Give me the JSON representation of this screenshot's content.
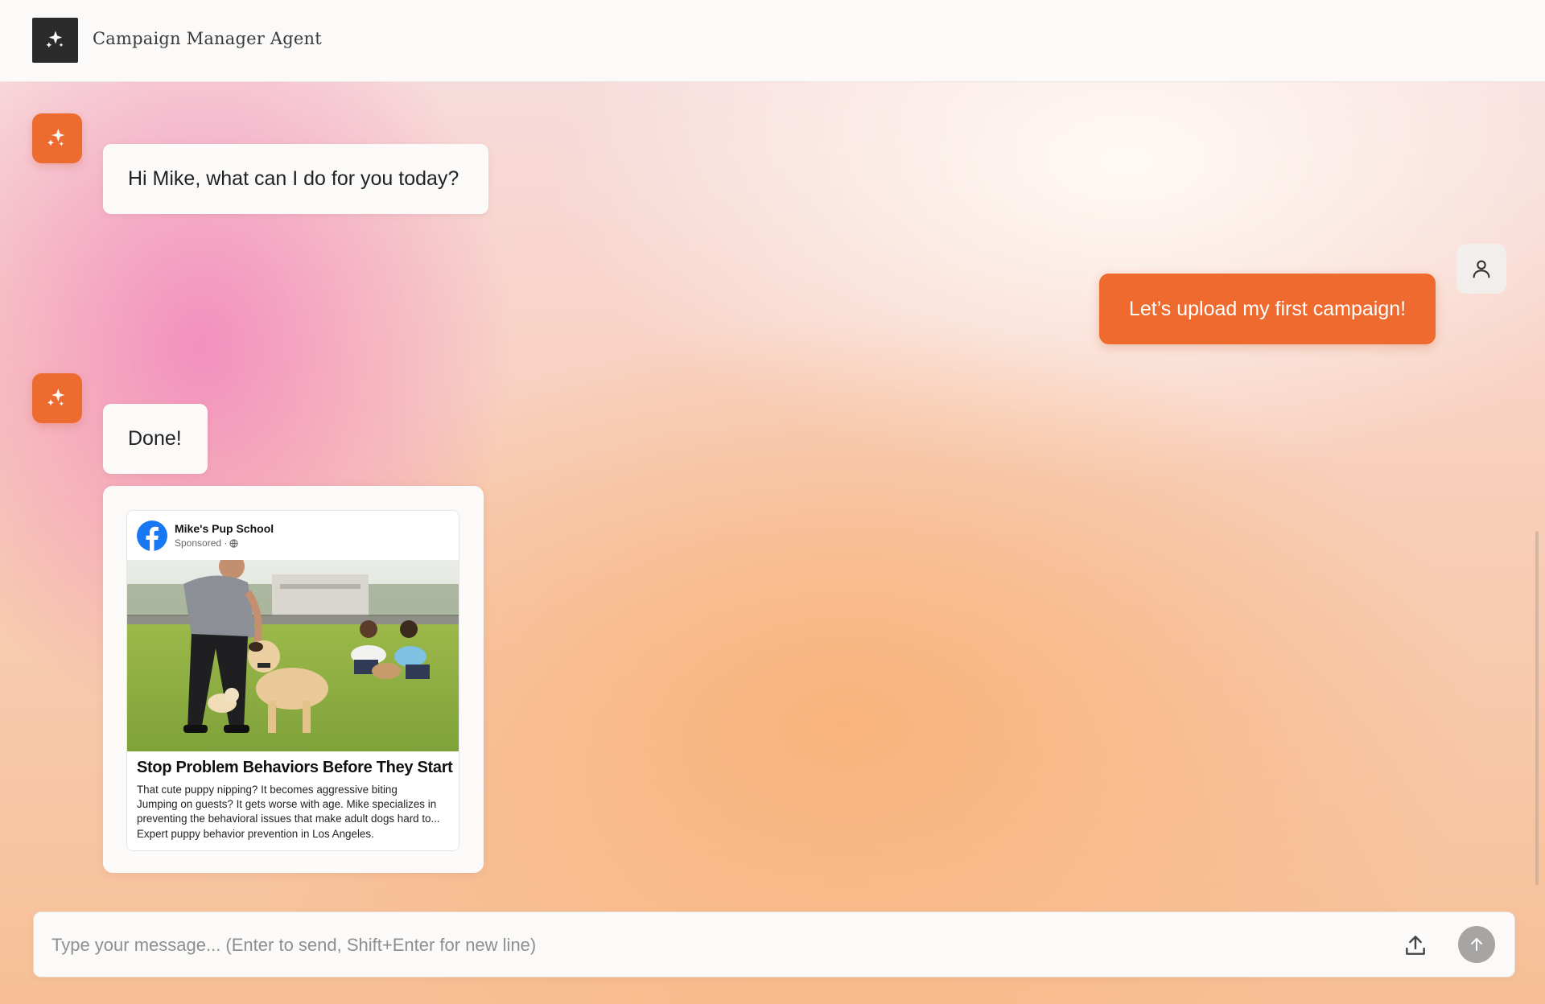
{
  "header": {
    "title": "Campaign Manager Agent",
    "logo_icon": "sparkles-icon"
  },
  "messages": [
    {
      "role": "assistant",
      "text": "Hi Mike, what can I do for you today?"
    },
    {
      "role": "user",
      "text": "Let’s upload my first campaign!"
    },
    {
      "role": "assistant",
      "text": "Done!"
    }
  ],
  "ad_preview": {
    "page_name": "Mike's Pup School",
    "sponsored": "Sponsored · ",
    "globe_icon": "globe-icon",
    "platform_icon": "facebook-icon",
    "headline": "Stop Problem Behaviors Before They Start",
    "body_lines": [
      "That cute puppy nipping? It becomes aggressive biting",
      "Jumping on guests? It gets worse with age. Mike specializes in",
      "preventing the behavioral issues that make adult dogs hard to..."
    ],
    "footer": "Expert puppy behavior prevention in Los Angeles."
  },
  "composer": {
    "placeholder": "Type your message... (Enter to send, Shift+Enter for new line)",
    "value": "",
    "upload_icon": "upload-icon",
    "send_icon": "send-arrow-icon"
  },
  "colors": {
    "accent": "#ee6a2e",
    "header_bg": "#fbfaf8",
    "logo_bg": "#2b2b2b",
    "send_disabled": "#a7a5a3"
  }
}
